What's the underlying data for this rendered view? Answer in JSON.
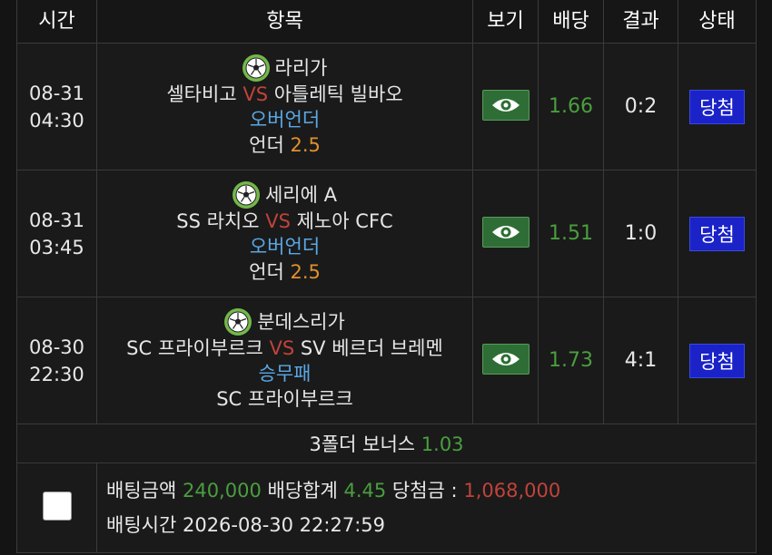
{
  "header": {
    "time": "시간",
    "item": "항목",
    "view": "보기",
    "odds": "배당",
    "result": "결과",
    "status": "상태"
  },
  "bets": [
    {
      "date": "08-31",
      "time": "04:30",
      "league": "라리가",
      "home": "셀타비고",
      "vs": "VS",
      "away": "아틀레틱 빌바오",
      "market": "오버언더",
      "pick": "언더",
      "line": "2.5",
      "odds": "1.66",
      "result": "0:2",
      "status": "당첨"
    },
    {
      "date": "08-31",
      "time": "03:45",
      "league": "세리에 A",
      "home": "SS 라치오",
      "vs": "VS",
      "away": "제노아 CFC",
      "market": "오버언더",
      "pick": "언더",
      "line": "2.5",
      "odds": "1.51",
      "result": "1:0",
      "status": "당첨"
    },
    {
      "date": "08-30",
      "time": "22:30",
      "league": "분데스리가",
      "home": "SC 프라이부르크",
      "vs": "VS",
      "away": "SV 베르더 브레멘",
      "market": "승무패",
      "pick": "SC 프라이부르크",
      "line": "",
      "odds": "1.73",
      "result": "4:1",
      "status": "당첨"
    }
  ],
  "bonus": {
    "label": "3폴더 보너스",
    "value": "1.03"
  },
  "summary": {
    "amount_label": "배팅금액",
    "amount": "240,000",
    "total_odds_label": "배당합계",
    "total_odds": "4.45",
    "win_label": "당첨금 :",
    "win_amount": "1,068,000",
    "time_label": "배팅시간",
    "time": "2026-08-30 22:27:59"
  },
  "colors": {
    "vs": "#c0433b",
    "market": "#5aa8e6",
    "line": "#e0902e",
    "odds": "#4a9e3f",
    "status_button": "#1a22c8",
    "win_amount": "#c0433b"
  },
  "icons": {
    "league": "soccer-ball-icon",
    "view": "eye-icon"
  }
}
